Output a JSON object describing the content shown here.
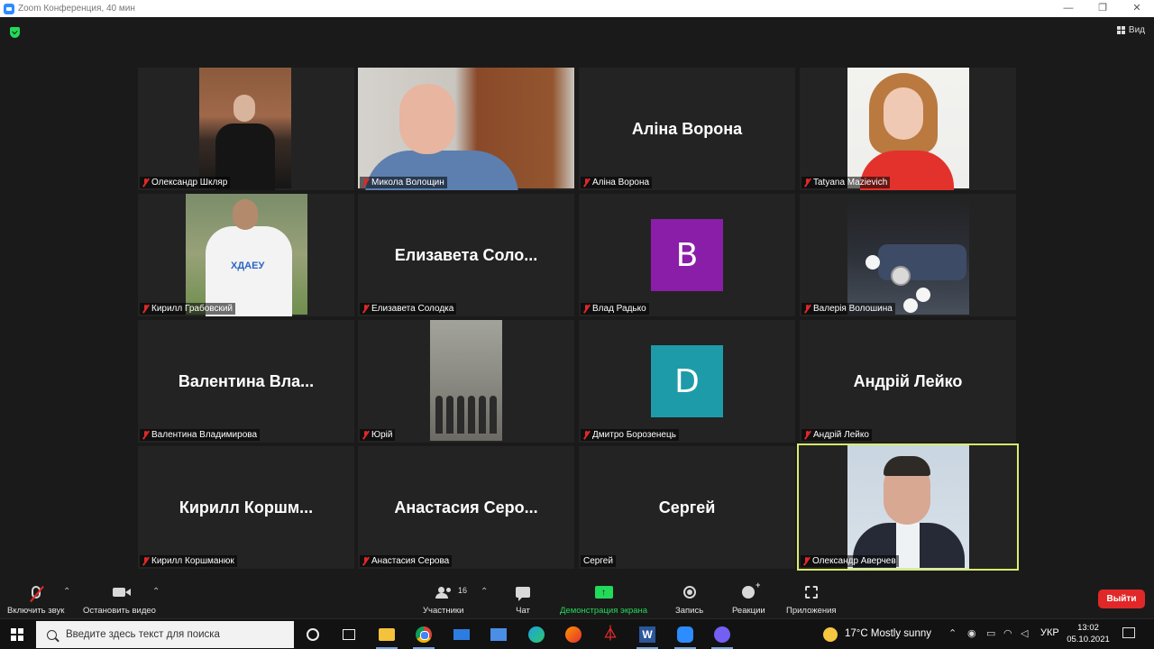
{
  "window": {
    "title": "Zoom Конференция, 40 мин",
    "controls": [
      "—",
      "❐",
      "✕"
    ]
  },
  "view_label": "Вид",
  "participants": [
    {
      "id": "shklyar",
      "label": "Олександр Шкляр",
      "display": "photo",
      "muted": true
    },
    {
      "id": "voloshchyn",
      "label": "Микола Волощин",
      "display": "photo",
      "muted": true
    },
    {
      "id": "vorona",
      "label": "Аліна Ворона",
      "big_name": "Аліна Ворона",
      "display": "name",
      "muted": true
    },
    {
      "id": "mazievich",
      "label": "Tatyana Mazievich",
      "display": "photo",
      "muted": true
    },
    {
      "id": "grabovsky",
      "label": "Кирилл Грабовский",
      "display": "photo",
      "muted": true,
      "photo_text": "ХДАЕУ"
    },
    {
      "id": "solodka",
      "label": "Елизавета Солодка",
      "big_name": "Елизавета  Соло...",
      "display": "name",
      "muted": true
    },
    {
      "id": "radko",
      "label": "Влад Радько",
      "avatar_letter": "B",
      "avatar_color": "#8a1ea8",
      "display": "avatar",
      "muted": true
    },
    {
      "id": "voloshyna",
      "label": "Валерія Волошина",
      "display": "photo",
      "muted": true
    },
    {
      "id": "vladimirova",
      "label": "Валентина Владимирова",
      "big_name": "Валентина  Вла...",
      "display": "name",
      "muted": true
    },
    {
      "id": "yuriy",
      "label": "Юрій",
      "display": "photo-small",
      "muted": true
    },
    {
      "id": "borozenets",
      "label": "Дмитро Борозенець",
      "avatar_letter": "D",
      "avatar_color": "#1e9ba8",
      "display": "avatar",
      "muted": true
    },
    {
      "id": "leyko",
      "label": "Андрій Лейко",
      "big_name": "Андрій Лейко",
      "display": "name",
      "muted": true
    },
    {
      "id": "korshmanuk",
      "label": "Кирилл Коршманюк",
      "big_name": "Кирилл  Коршм...",
      "display": "name",
      "muted": true
    },
    {
      "id": "serova",
      "label": "Анастасия Серова",
      "big_name": "Анастасия  Серо...",
      "display": "name",
      "muted": true
    },
    {
      "id": "sergey",
      "label": "Сергей",
      "big_name": "Сергей",
      "display": "name",
      "muted": false
    },
    {
      "id": "averchev",
      "label": "Олександр Аверчев",
      "display": "photo",
      "muted": true,
      "active_speaker": true
    }
  ],
  "toolbar": {
    "unmute_label": "Включить звук",
    "stop_video_label": "Остановить видео",
    "participants_label": "Участники",
    "participants_count": "16",
    "chat_label": "Чат",
    "share_label": "Демонстрация экрана",
    "record_label": "Запись",
    "reactions_label": "Реакции",
    "apps_label": "Приложения",
    "leave_label": "Выйти",
    "accent_color": "#23d959",
    "leave_color": "#e02828"
  },
  "taskbar": {
    "search_placeholder": "Введите здесь текст для поиска",
    "weather": "17°C  Mostly sunny",
    "language": "УКР",
    "time": "13:02",
    "date": "05.10.2021",
    "icons": [
      "cortana-icon",
      "task-view-icon",
      "file-explorer-icon",
      "chrome-icon",
      "mail-icon",
      "store-icon",
      "edge-icon",
      "firefox-icon",
      "acrobat-icon",
      "word-icon",
      "zoom-icon",
      "viber-icon"
    ]
  }
}
